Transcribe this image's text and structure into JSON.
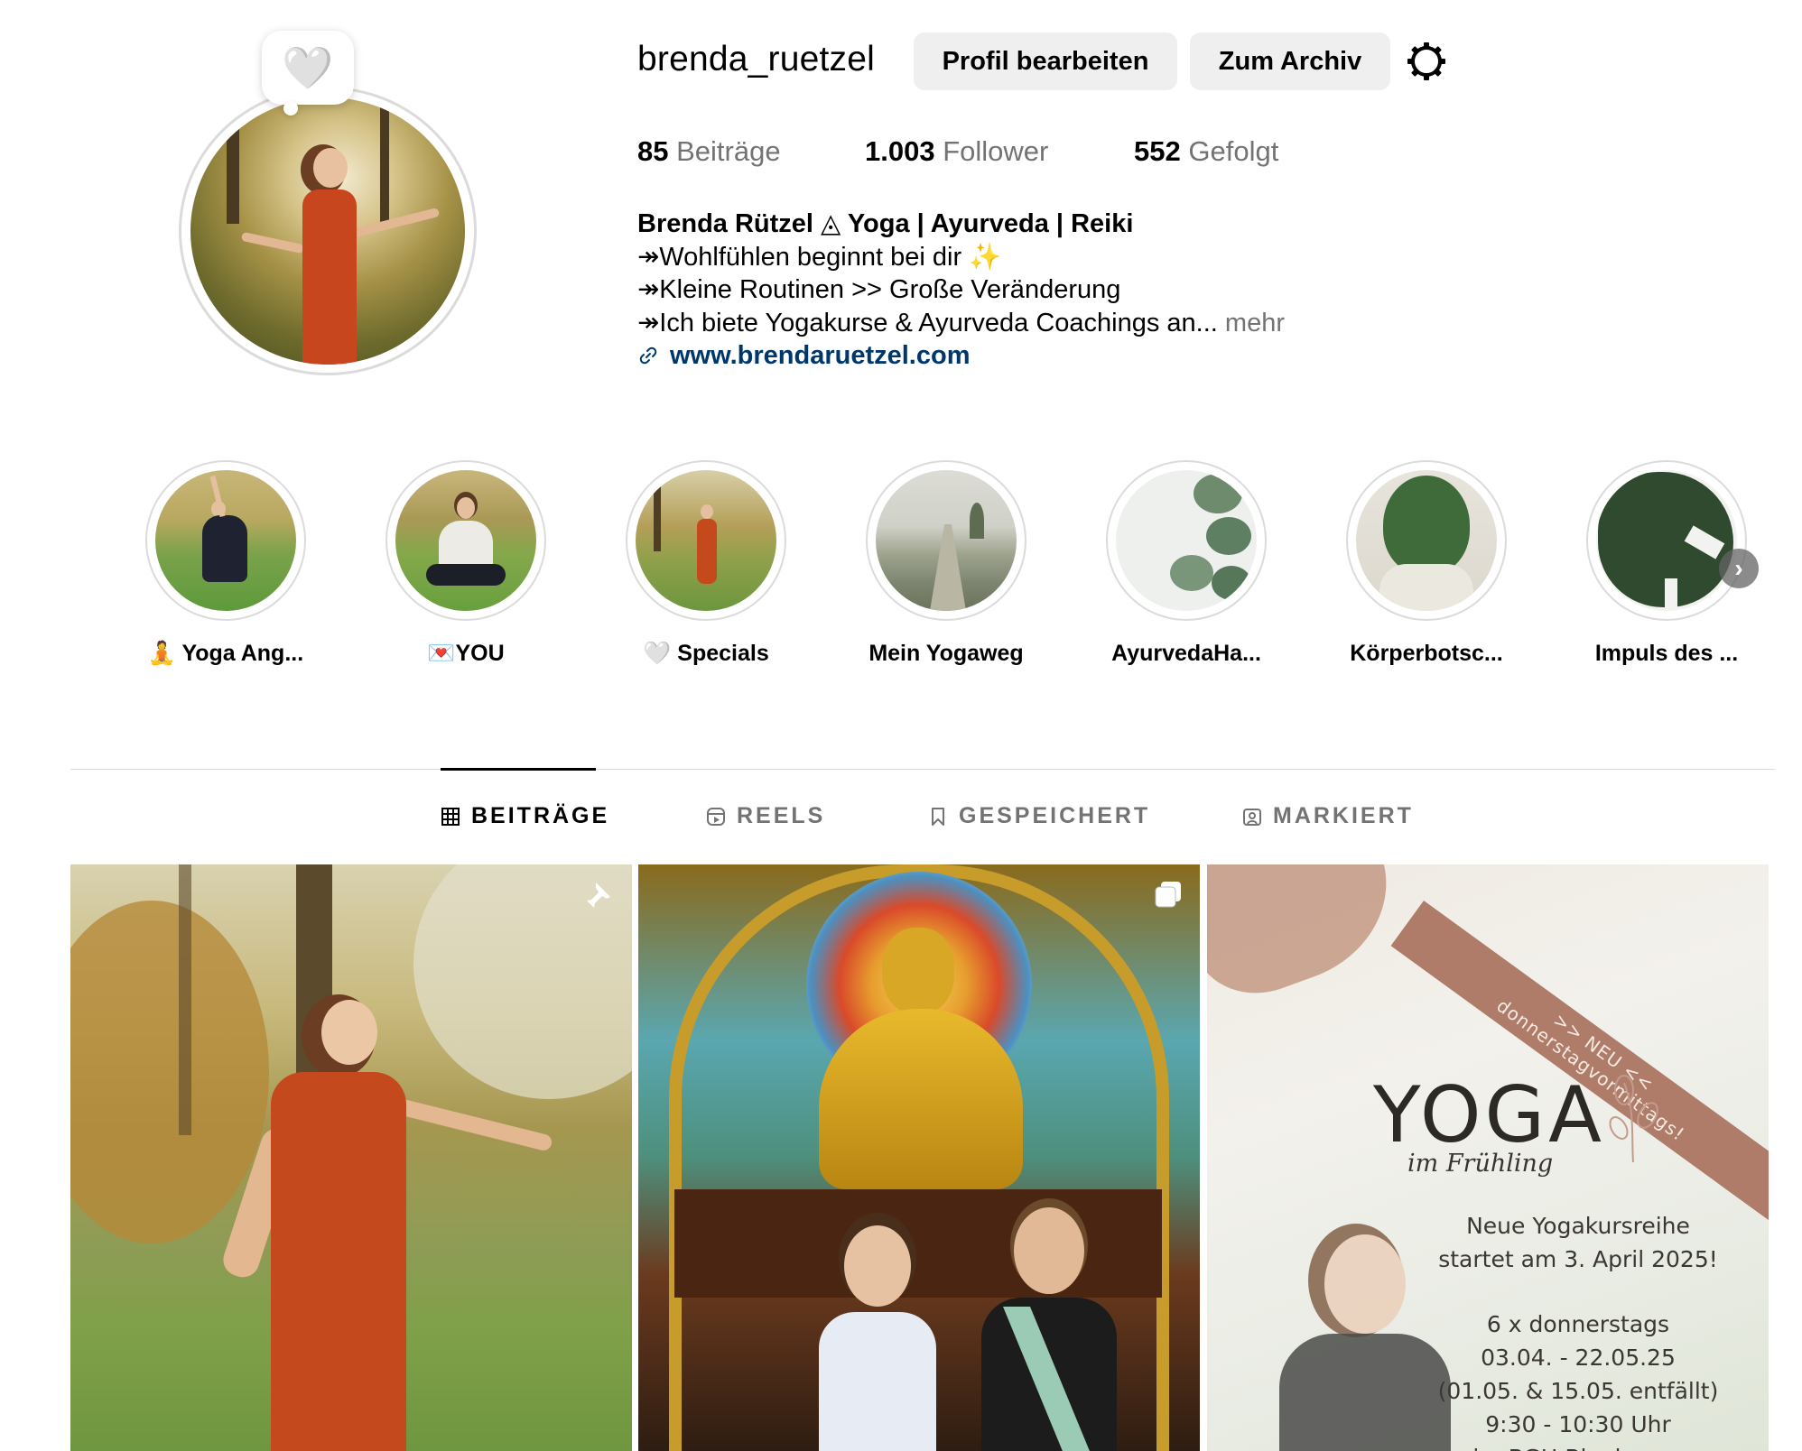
{
  "profile": {
    "username": "brenda_ruetzel",
    "note_icon": "white-heart",
    "edit_label": "Profil bearbeiten",
    "archive_label": "Zum Archiv",
    "settings_icon": "gear-icon"
  },
  "stats": {
    "posts_count": "85",
    "posts_label": "Beiträge",
    "followers_count": "1.003",
    "followers_label": "Follower",
    "following_count": "552",
    "following_label": "Gefolgt"
  },
  "bio": {
    "name": "Brenda Rützel ◬ Yoga | Ayurveda | Reiki",
    "line1": "↠Wohlfühlen beginnt bei dir ✨",
    "line2": "↠Kleine Routinen >> Große Veränderung",
    "line3": "↠Ich biete Yogakurse & Ayurveda Coachings an...",
    "more": " mehr",
    "link": "www.brendaruetzel.com"
  },
  "highlights": [
    {
      "label": "🧘 Yoga Ang..."
    },
    {
      "label": "💌YOU"
    },
    {
      "label": "🤍 Specials"
    },
    {
      "label": "Mein Yogaweg"
    },
    {
      "label": "AyurvedaHa..."
    },
    {
      "label": "Körperbotsc..."
    },
    {
      "label": "Impuls des ..."
    }
  ],
  "tabs": {
    "posts": "BEITRÄGE",
    "reels": "REELS",
    "saved": "GESPEICHERT",
    "tagged": "MARKIERT"
  },
  "posts": {
    "post3": {
      "banner_line1": ">> NEU <<",
      "banner_line2": "donnerstagvormittags!",
      "title": "YOGA",
      "script": "im Frühling",
      "text1": "Neue Yogakursreihe",
      "text2": "startet am 3. April 2025!",
      "text3": "6 x donnerstags",
      "text4": "03.04. - 22.05.25",
      "text5": "(01.05. & 15.05. entfällt)",
      "text6": "9:30 - 10:30 Uhr",
      "text7": "im BGH Blankenau"
    }
  },
  "colors": {
    "accent_link": "#00376b",
    "button_bg": "#efefef",
    "muted_text": "#737373",
    "divider": "#dbdbdb"
  }
}
